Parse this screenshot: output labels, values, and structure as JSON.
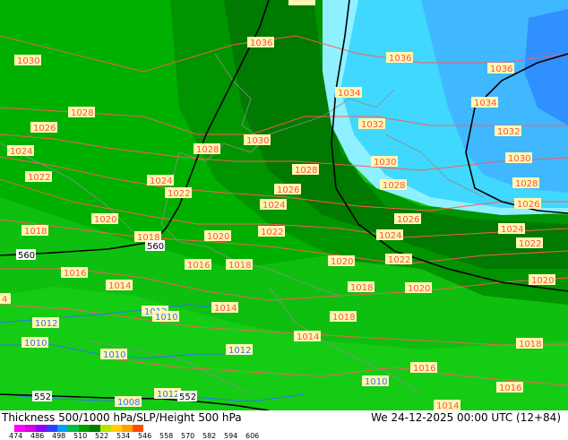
{
  "title_left": "Thickness 500/1000 hPa/SLP/Height 500 hPa",
  "title_right": "We 24-12-2025 00:00 UTC (12+84)",
  "scale_ticks": [
    "474",
    "486",
    "498",
    "510",
    "522",
    "534",
    "546",
    "558",
    "570",
    "582",
    "594",
    "606"
  ],
  "scale_colors": [
    "#ff00ff",
    "#d000e0",
    "#9000ff",
    "#3040ff",
    "#00a0ff",
    "#00c040",
    "#00a000",
    "#008000",
    "#c0e000",
    "#ffd000",
    "#ffa000",
    "#ff5000"
  ],
  "colors": {
    "green_bright": "#10c010",
    "green_mid": "#00b400",
    "green_dark": "#009600",
    "green_darker": "#007a00",
    "cyan_light": "#8ff0ff",
    "cyan_mid": "#40d8ff",
    "blue_light": "#40b0ff",
    "isobar": "#ff5050",
    "isohypse": "#000000",
    "coast": "#909090"
  },
  "slp_labels": [
    "1036",
    "1036",
    "1036",
    "1030",
    "1028",
    "1026",
    "1024",
    "1022",
    "1020",
    "1018",
    "1034",
    "1034",
    "1032",
    "1032",
    "1030",
    "1030",
    "1028",
    "1028",
    "1026",
    "1024",
    "1022",
    "1020",
    "1018",
    "1016",
    "1014",
    "1012",
    "1010",
    "1008",
    "1020",
    "1018",
    "1016",
    "1018",
    "1014",
    "1012",
    "1010",
    "1014",
    "1016",
    "1018",
    "1016",
    "1014",
    "1010",
    "1012",
    "1010",
    "1012",
    "1024",
    "1022",
    "1020",
    "1024",
    "1026",
    "1028",
    "1030",
    "1028",
    "1026",
    "1022",
    "1020",
    "1022",
    "1018",
    "1016",
    "1014",
    "1012",
    "1028",
    "1030",
    "1032"
  ],
  "height_labels": [
    "560",
    "560",
    "552",
    "552"
  ]
}
